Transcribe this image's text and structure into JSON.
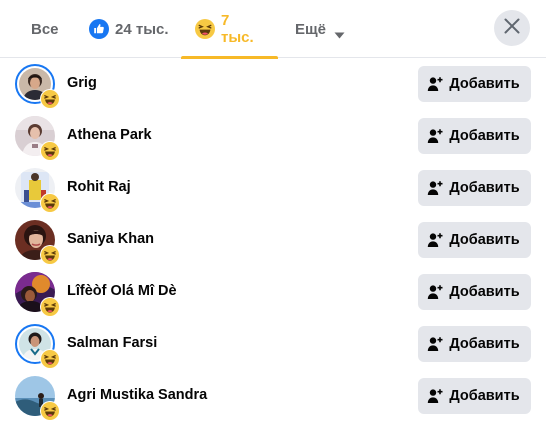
{
  "tabs": {
    "all": "Все",
    "like": "24 тыс.",
    "haha": "7 тыс.",
    "more": "Ещё"
  },
  "icons": {
    "like": "like-reaction-icon",
    "haha": "haha-reaction-icon",
    "more": "chevron-down-icon",
    "close": "close-icon",
    "add": "add-friend-icon"
  },
  "colors": {
    "accent": "#f7b928",
    "like_blue": "#1877f2",
    "button_bg": "#e4e6eb",
    "secondary_text": "#65676b"
  },
  "people": [
    {
      "name": "Grig",
      "button": "Добавить",
      "story_ring": true
    },
    {
      "name": "Athena Park",
      "button": "Добавить",
      "story_ring": false
    },
    {
      "name": "Rohit Raj",
      "button": "Добавить",
      "story_ring": false
    },
    {
      "name": "Saniya Khan",
      "button": "Добавить",
      "story_ring": false
    },
    {
      "name": "Lîfèòf Olá Mî Dè",
      "button": "Добавить",
      "story_ring": false
    },
    {
      "name": "Salman Farsi",
      "button": "Добавить",
      "story_ring": true
    },
    {
      "name": "Agri Mustika Sandra",
      "button": "Добавить",
      "story_ring": false
    }
  ]
}
